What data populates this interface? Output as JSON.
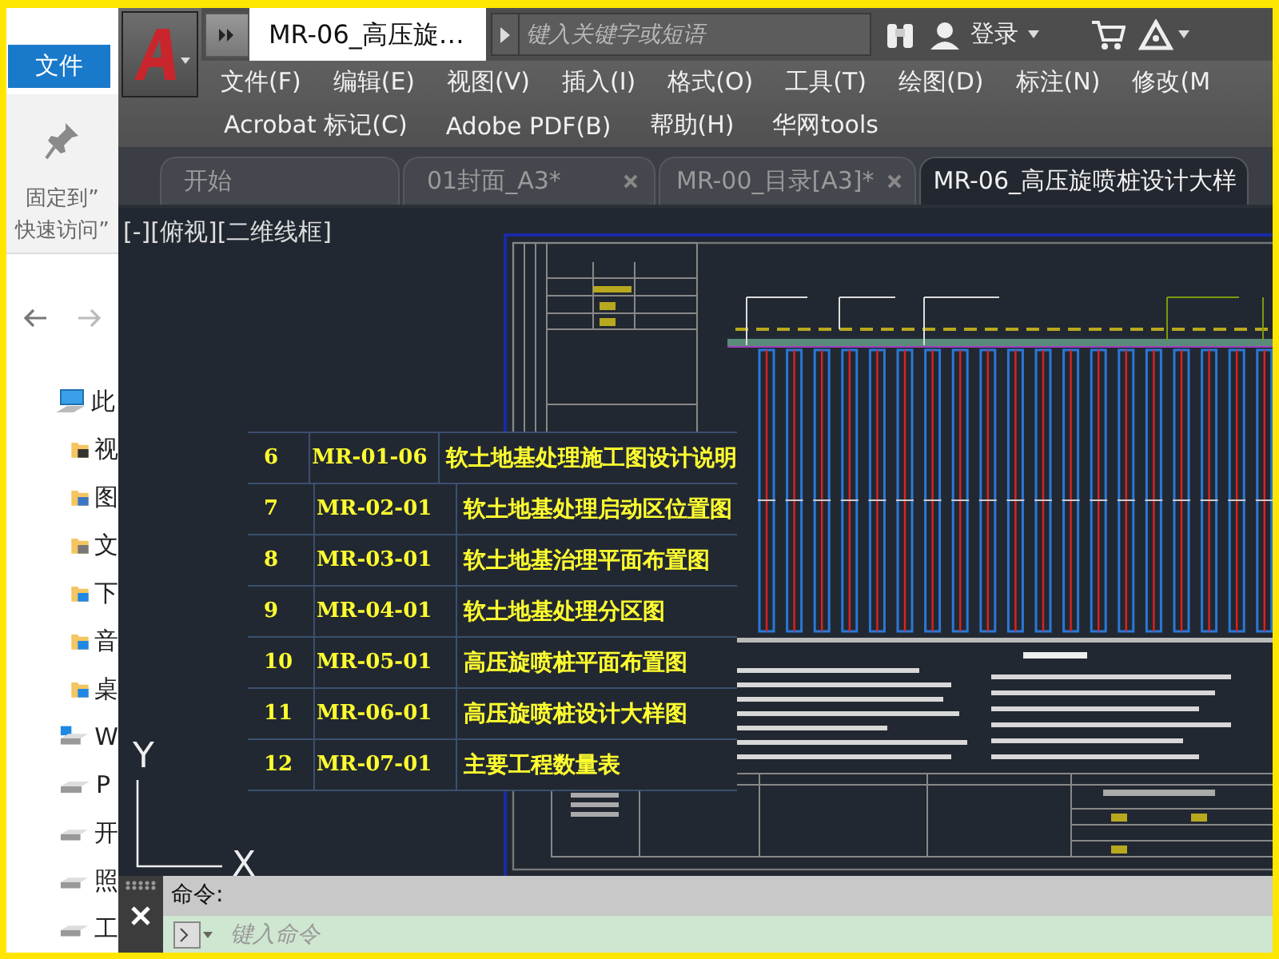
{
  "explorer": {
    "ribbon_tab": "文件",
    "pin_lines": [
      "固定到”",
      "快速访问”"
    ],
    "tree": [
      {
        "label": "此",
        "kind": "computer",
        "children": [
          {
            "label": "视",
            "kind": "folder-video"
          },
          {
            "label": "图",
            "kind": "folder-picture"
          },
          {
            "label": "文",
            "kind": "folder-document"
          },
          {
            "label": "下",
            "kind": "folder-download"
          },
          {
            "label": "音",
            "kind": "folder-music"
          },
          {
            "label": "桌",
            "kind": "folder-desktop"
          },
          {
            "label": "W",
            "kind": "drive-windows"
          },
          {
            "label": "P",
            "kind": "drive"
          },
          {
            "label": "开",
            "kind": "drive"
          },
          {
            "label": "照",
            "kind": "drive"
          },
          {
            "label": "工",
            "kind": "drive"
          }
        ]
      }
    ]
  },
  "app": {
    "title": "MR-06_高压旋…",
    "search": {
      "placeholder": "键入关键字或短语"
    },
    "sign_in": "登录",
    "menu_rows": [
      [
        "文件(F)",
        "编辑(E)",
        "视图(V)",
        "插入(I)",
        "格式(O)",
        "工具(T)",
        "绘图(D)",
        "标注(N)",
        "修改(M"
      ],
      [
        "Acrobat 标记(C)",
        "Adobe PDF(B)",
        "帮助(H)",
        "华网tools"
      ]
    ],
    "tabs": [
      {
        "label": "开始",
        "selected": false,
        "closable": false
      },
      {
        "label": "01封面_A3*",
        "selected": false,
        "closable": true
      },
      {
        "label": "MR-00_目录[A3]*",
        "selected": false,
        "closable": true
      },
      {
        "label": "MR-06_高压旋喷桩设计大样",
        "selected": true,
        "closable": false
      }
    ],
    "viewport_label": "[-][俯视][二维线框]",
    "drawing_list": [
      {
        "number": "6",
        "code": "MR-01-06",
        "title": "软土地基处理施工图设计说明"
      },
      {
        "number": "7",
        "code": "MR-02-01",
        "title": "软土地基处理启动区位置图"
      },
      {
        "number": "8",
        "code": "MR-03-01",
        "title": "软土地基治理平面布置图"
      },
      {
        "number": "9",
        "code": "MR-04-01",
        "title": "软土地基处理分区图"
      },
      {
        "number": "10",
        "code": "MR-05-01",
        "title": "高压旋喷桩平面布置图"
      },
      {
        "number": "11",
        "code": "MR-06-01",
        "title": "高压旋喷桩设计大样图"
      },
      {
        "number": "12",
        "code": "MR-07-01",
        "title": "主要工程数量表"
      }
    ],
    "ucs": {
      "y_label": "Y",
      "x_label": "X"
    },
    "command": {
      "history": "命令:",
      "placeholder": "键入命令"
    }
  }
}
